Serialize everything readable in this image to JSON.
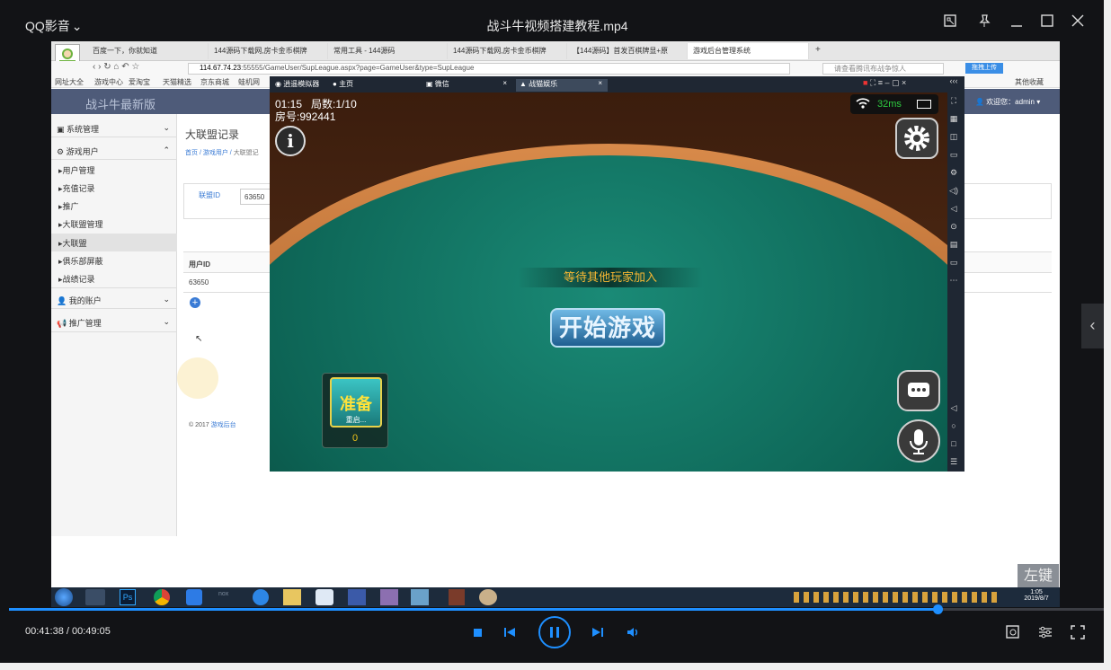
{
  "player": {
    "app_name": "QQ影音",
    "dropdown_glyph": "⌄",
    "file_title": "战斗牛视频搭建教程.mp4",
    "time_display": "00:41:38 / 00:49:05",
    "progress": 0.848,
    "watermark": "左键",
    "side_arrow": "‹",
    "accent": "#1e8fff"
  },
  "browser": {
    "tabs": [
      "百度一下，你就知道",
      "144源码下载网,房卡金币棋牌",
      "常用工具 - 144源码",
      "144源码下载网,房卡金币棋牌",
      "【144源码】首发百棋牌显+原",
      "游戏后台管理系统"
    ],
    "tab_close": "×",
    "new_tab": "+",
    "url_host": "114.67.74.23",
    "url_rest": ":55555/GameUser/SupLeague.aspx?page=GameUser&type=SupLeague",
    "search_placeholder": "请查看腾讯布战争惊人",
    "cloud_btn": "拖拽上传",
    "bookmarks": [
      "网址大全",
      "游戏中心",
      "爱淘宝",
      "天猫精选",
      "京东商城",
      "蛙机网"
    ],
    "bookmark_right": "其他收藏"
  },
  "admin": {
    "brand": "战斗牛最新版",
    "welcome": "欢迎您：admin ▾",
    "menu": {
      "system": "系统管理",
      "game_users": "游戏用户",
      "items": [
        "用户管理",
        "充值记录",
        "推广",
        "大联盟管理",
        "大联盟",
        "俱乐部屏蔽",
        "战绩记录"
      ],
      "my_account": "我的账户",
      "promo": "推广管理"
    },
    "page_title": "大联盟记录",
    "breadcrumb": [
      "首页",
      "游戏用户",
      "大联盟记"
    ],
    "filter_label": "联盟ID",
    "filter_value": "63650",
    "table_header": "用户ID",
    "table_row": "63650",
    "footer": "© 2017",
    "footer_link": "游戏后台"
  },
  "emulator": {
    "tabs": [
      "逍遥模拟器",
      "主页",
      "微信",
      "战猫娱乐"
    ],
    "time": "01:15",
    "round": "局数:1/10",
    "room": "房号:992441",
    "ping": "32ms",
    "waiting": "等待其他玩家加入",
    "start_btn": "开始游戏",
    "ready_label": "准备",
    "ready_sub": "重启...",
    "score": "0"
  },
  "taskbar": {
    "clock_time": "1:05",
    "clock_date": "2019/8/7",
    "icons": [
      "windows-start",
      "app",
      "Ps",
      "chrome",
      "pen",
      "nox",
      "S",
      "folder",
      "cloud",
      "app",
      "app",
      "app",
      "app",
      "app"
    ]
  }
}
